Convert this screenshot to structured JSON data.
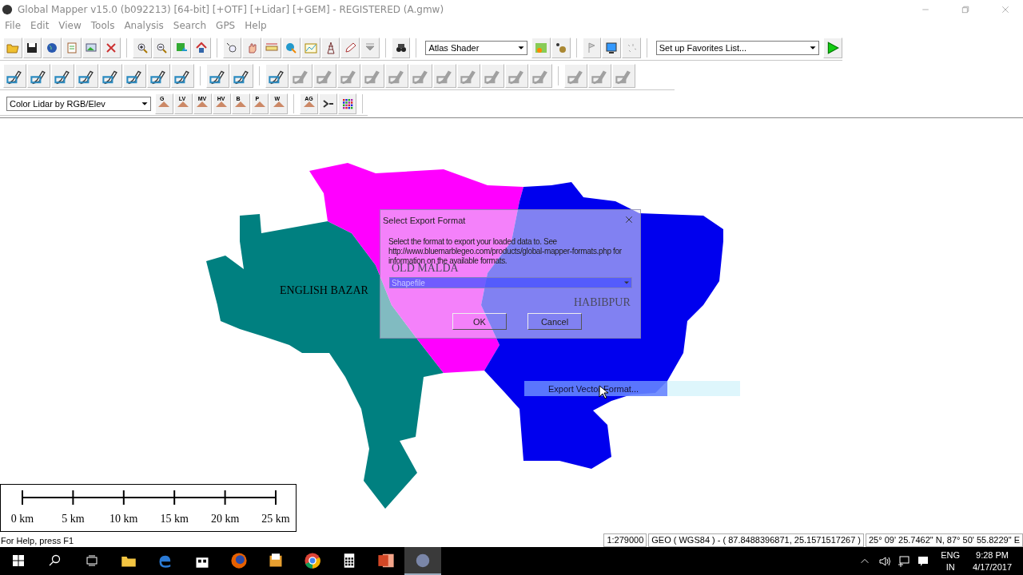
{
  "window": {
    "title": "Global Mapper v15.0 (b092213) [64-bit] [+OTF] [+Lidar] [+GEM] - REGISTERED (A.gmw)"
  },
  "menu": [
    "File",
    "Edit",
    "View",
    "Tools",
    "Analysis",
    "Search",
    "GPS",
    "Help"
  ],
  "toolbar_main": {
    "shader": "Atlas Shader",
    "favorites": "Set up Favorites List..."
  },
  "toolbar_digitizer": [
    {
      "disabled": false
    },
    {
      "disabled": false
    },
    {
      "disabled": false
    },
    {
      "disabled": false
    },
    {
      "disabled": false
    },
    {
      "disabled": false
    },
    {
      "disabled": false
    },
    {
      "disabled": false
    },
    {
      "disabled": false
    },
    {
      "disabled": false
    },
    {
      "disabled": false
    },
    {
      "disabled": true
    },
    {
      "disabled": true
    },
    {
      "disabled": true
    },
    {
      "disabled": true
    },
    {
      "disabled": true
    },
    {
      "disabled": true
    },
    {
      "disabled": true
    },
    {
      "disabled": true
    },
    {
      "disabled": true
    },
    {
      "disabled": true
    },
    {
      "disabled": true
    },
    {
      "disabled": true
    },
    {
      "disabled": true
    },
    {
      "disabled": true
    }
  ],
  "toolbar_lidar": {
    "mode": "Color Lidar by RGB/Elev",
    "buttons": [
      {
        "label": "G"
      },
      {
        "label": "LV"
      },
      {
        "label": "MV"
      },
      {
        "label": "HV"
      },
      {
        "label": "B"
      },
      {
        "label": "P"
      },
      {
        "label": "W"
      },
      {
        "label": "AG"
      }
    ]
  },
  "map": {
    "regions": [
      {
        "name": "ENGLISH BAZAR",
        "color": "#008080"
      },
      {
        "name": "OLD MALDA",
        "color": "#ff00ff"
      },
      {
        "name": "HABIBPUR",
        "color": "#0000ee"
      }
    ],
    "scale_labels": [
      "0 km",
      "5 km",
      "10 km",
      "15 km",
      "20 km",
      "25 km"
    ]
  },
  "dialog": {
    "title": "Select Export Format",
    "message": "Select the format to export your loaded data to. See http://www.bluemarblegeo.com/products/global-mapper-formats.php for information on the available formats.",
    "format": "Shapefile",
    "buttons": [
      "OK",
      "Cancel"
    ]
  },
  "menu_item": {
    "label": "Export Vector Format..."
  },
  "status_bar": {
    "help": "For Help, press F1",
    "scale": "1:279000",
    "projection": "GEO ( WGS84 ) - ( 87.8488396871, 25.1571517267 )",
    "position": "25° 09' 25.7462\" N, 87° 50' 55.8229\" E"
  },
  "taskbar": {
    "apps": [
      {
        "kind": "folder",
        "selected": false
      },
      {
        "kind": "edge",
        "selected": false
      },
      {
        "kind": "store",
        "selected": false
      },
      {
        "kind": "firefox",
        "selected": false
      },
      {
        "kind": "files",
        "selected": false
      },
      {
        "kind": "chrome",
        "selected": false
      },
      {
        "kind": "calculator",
        "selected": false
      },
      {
        "kind": "powerpoint",
        "selected": false
      },
      {
        "kind": "globe",
        "selected": true
      }
    ],
    "language": "ENG",
    "region": "IN",
    "time": "9:28 PM",
    "date": "4/17/2017"
  }
}
